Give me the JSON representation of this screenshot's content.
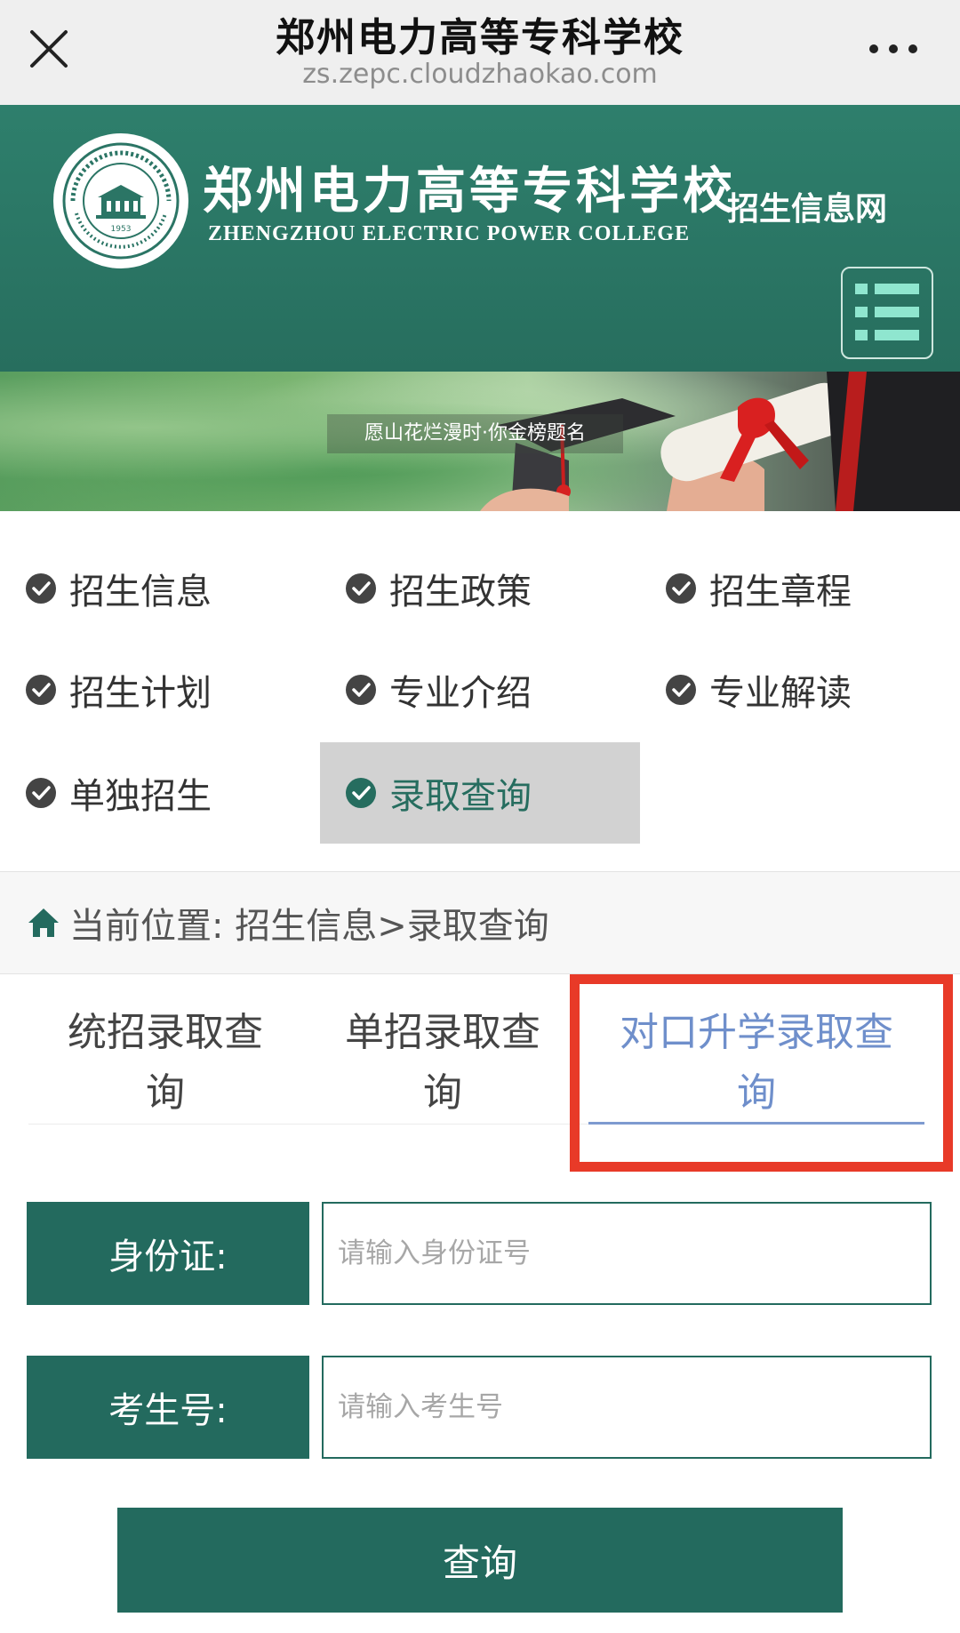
{
  "browser": {
    "title": "郑州电力高等专科学校",
    "url": "zs.zepc.cloudzhaokao.com"
  },
  "header": {
    "school_name": "郑州电力高等专科学校",
    "school_name_en": "ZHENGZHOU ELECTRIC POWER COLLEGE",
    "site_name": "招生信息网",
    "seal_year": "1953",
    "accent_color": "#2e7f6c"
  },
  "banner": {
    "slogan": "愿山花烂漫时·你金榜题名"
  },
  "nav": {
    "items": [
      {
        "label": "招生信息"
      },
      {
        "label": "招生政策"
      },
      {
        "label": "招生章程"
      },
      {
        "label": "招生计划"
      },
      {
        "label": "专业介绍"
      },
      {
        "label": "专业解读"
      },
      {
        "label": "单独招生"
      },
      {
        "label": "录取查询",
        "active": true
      }
    ]
  },
  "breadcrumb": {
    "text": "当前位置: 招生信息>录取查询"
  },
  "tabs": [
    {
      "line1": "统招录取查",
      "line2": "询"
    },
    {
      "line1": "单招录取查",
      "line2": "询"
    },
    {
      "line1": "对口升学录取查",
      "line2": "询",
      "active": true
    }
  ],
  "form": {
    "id_label": "身份证:",
    "id_placeholder": "请输入身份证号",
    "exam_label": "考生号:",
    "exam_placeholder": "请输入考生号",
    "submit_label": "查询"
  },
  "colors": {
    "primary": "#236a5e",
    "active_tab": "#6f8fcb",
    "highlight": "#e83a28"
  }
}
